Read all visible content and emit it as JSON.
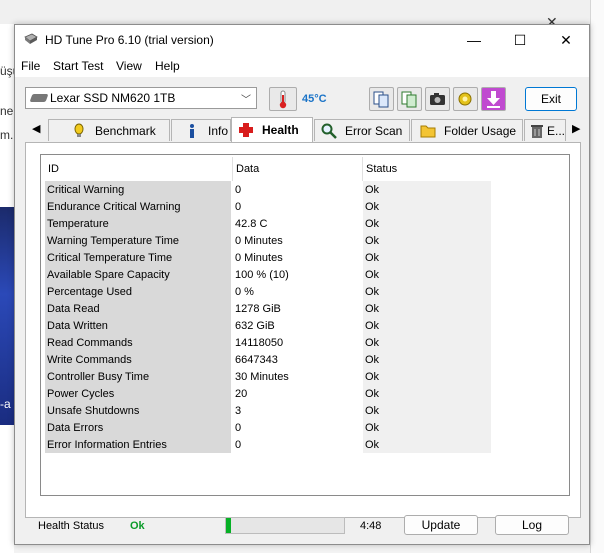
{
  "background": {
    "left_fragments": [
      "üşü",
      "ne",
      "m."
    ],
    "left_bottom_fragment": "-a"
  },
  "window": {
    "title": "HD Tune Pro 6.10 (trial version)",
    "controls": {
      "minimize": "—",
      "maximize": "☐",
      "close": "✕"
    }
  },
  "menu": [
    "File",
    "Start Test",
    "View",
    "Help"
  ],
  "toolbar": {
    "drive": "Lexar SSD NM620 1TB",
    "temperature": "45°C",
    "exit_label": "Exit"
  },
  "tabs": [
    {
      "label": "Benchmark",
      "icon": "benchmark-icon",
      "active": false
    },
    {
      "label": "Info",
      "icon": "info-icon",
      "active": false
    },
    {
      "label": "Health",
      "icon": "health-icon",
      "active": true
    },
    {
      "label": "Error Scan",
      "icon": "magnifier-icon",
      "active": false
    },
    {
      "label": "Folder Usage",
      "icon": "folder-icon",
      "active": false
    },
    {
      "label": "E...",
      "icon": "trash-icon",
      "active": false
    }
  ],
  "table": {
    "headers": [
      "ID",
      "Data",
      "Status"
    ],
    "rows": [
      [
        "Critical Warning",
        "0",
        "Ok"
      ],
      [
        "Endurance Critical Warning",
        "0",
        "Ok"
      ],
      [
        "Temperature",
        "42.8 C",
        "Ok"
      ],
      [
        "Warning Temperature Time",
        "0 Minutes",
        "Ok"
      ],
      [
        "Critical Temperature Time",
        "0 Minutes",
        "Ok"
      ],
      [
        "Available Spare Capacity",
        "100 % (10)",
        "Ok"
      ],
      [
        "Percentage Used",
        "0 %",
        "Ok"
      ],
      [
        "Data Read",
        "1278 GiB",
        "Ok"
      ],
      [
        "Data Written",
        "632 GiB",
        "Ok"
      ],
      [
        "Read Commands",
        "14118050",
        "Ok"
      ],
      [
        "Write Commands",
        "6647343",
        "Ok"
      ],
      [
        "Controller Busy Time",
        "30 Minutes",
        "Ok"
      ],
      [
        "Power Cycles",
        "20",
        "Ok"
      ],
      [
        "Unsafe Shutdowns",
        "3",
        "Ok"
      ],
      [
        "Data Errors",
        "0",
        "Ok"
      ],
      [
        "Error Information Entries",
        "0",
        "Ok"
      ]
    ]
  },
  "footer": {
    "health_status_label": "Health Status",
    "health_status_value": "Ok",
    "progress_fraction": 0.04,
    "time": "4:48",
    "update_label": "Update",
    "log_label": "Log"
  },
  "colors": {
    "ok_green": "#0a9b28",
    "temp_blue": "#1a73c7",
    "progress_green": "#06b025",
    "accent_border": "#0078d4"
  }
}
